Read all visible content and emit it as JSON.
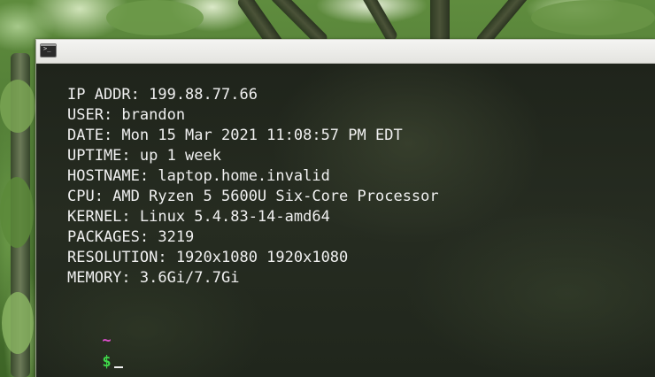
{
  "terminal": {
    "title_icon": "terminal-icon",
    "prompt_glyph": ">_",
    "lines": [
      "IP ADDR: 199.88.77.66",
      "USER: brandon",
      "DATE: Mon 15 Mar 2021 11:08:57 PM EDT",
      "UPTIME: up 1 week",
      "HOSTNAME: laptop.home.invalid",
      "CPU: AMD Ryzen 5 5600U Six-Core Processor",
      "KERNEL: Linux 5.4.83-14-amd64",
      "PACKAGES: 3219",
      "RESOLUTION: 1920x1080 1920x1080",
      "MEMORY: 3.6Gi/7.7Gi"
    ],
    "prompt": {
      "path": "~",
      "symbol": "$",
      "path_color": "#e14fd0",
      "symbol_color": "#3fd84a",
      "input": ""
    }
  },
  "colors": {
    "terminal_text": "#f0f0f0",
    "terminal_background": "#1f241b",
    "titlebar": "#eeeeea"
  }
}
